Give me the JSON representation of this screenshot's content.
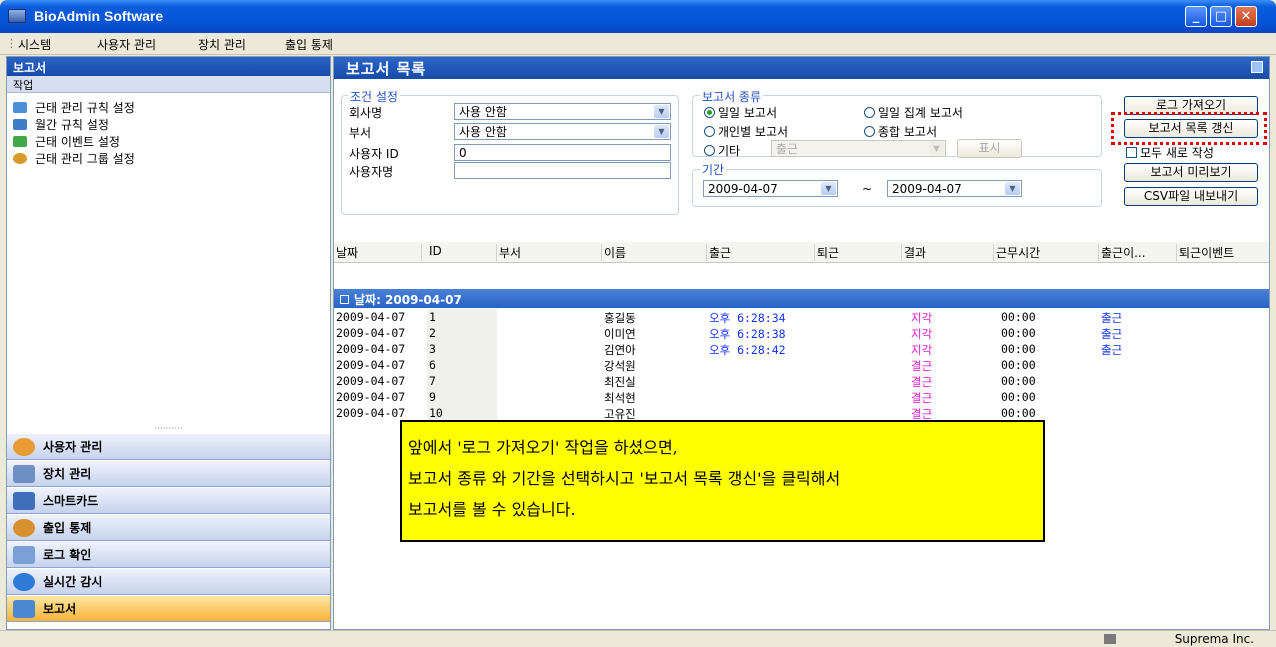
{
  "window": {
    "title": "BioAdmin Software"
  },
  "menu": [
    "시스템",
    "사용자 관리",
    "장치 관리",
    "출입 통제"
  ],
  "sidebar": {
    "header": "보고서",
    "subheader": "작업",
    "tasks": [
      "근태 관리 규칙 설정",
      "월간 규칙 설정",
      "근태 이벤트 설정",
      "근태 관리 그룹 설정"
    ],
    "nav": [
      "사용자 관리",
      "장치 관리",
      "스마트카드",
      "출입 통제",
      "로그 확인",
      "실시간 감시",
      "보고서"
    ]
  },
  "main": {
    "title": "보고서 목록",
    "conditions": {
      "legend": "조건 설정",
      "company_label": "회사명",
      "company_value": "사용 안함",
      "dept_label": "부서",
      "dept_value": "사용 안함",
      "userid_label": "사용자 ID",
      "userid_value": "0",
      "username_label": "사용자명",
      "username_value": ""
    },
    "report_type": {
      "legend": "보고서 종류",
      "options": [
        "일일 보고서",
        "일일 집계 보고서",
        "개인별 보고서",
        "종합 보고서",
        "기타"
      ],
      "selected": "일일 보고서",
      "other_combo": "출근",
      "show_button": "표시"
    },
    "period": {
      "legend": "기간",
      "from": "2009-04-07",
      "to": "2009-04-07",
      "sep": "~"
    },
    "buttons": {
      "fetch_log": "로그 가져오기",
      "refresh": "보고서 목록 갱신",
      "rewrite": "모두 새로 작성",
      "preview": "보고서 미리보기",
      "export_csv": "CSV파일 내보내기"
    },
    "grid": {
      "columns": [
        "날짜",
        "ID",
        "부서",
        "이름",
        "출근",
        "퇴근",
        "결과",
        "근무시간",
        "출근이...",
        "퇴근이벤트"
      ],
      "group_label": "날짜: 2009-04-07",
      "rows": [
        {
          "date": "2009-04-07",
          "id": "1",
          "dept": "",
          "name": "홍길동",
          "in": "오후 6:28:34",
          "out": "",
          "result": "지각",
          "hours": "00:00",
          "in_event": "출근"
        },
        {
          "date": "2009-04-07",
          "id": "2",
          "dept": "",
          "name": "이미연",
          "in": "오후 6:28:38",
          "out": "",
          "result": "지각",
          "hours": "00:00",
          "in_event": "출근"
        },
        {
          "date": "2009-04-07",
          "id": "3",
          "dept": "",
          "name": "김연아",
          "in": "오후 6:28:42",
          "out": "",
          "result": "지각",
          "hours": "00:00",
          "in_event": "출근"
        },
        {
          "date": "2009-04-07",
          "id": "6",
          "dept": "",
          "name": "강석원",
          "in": "",
          "out": "",
          "result": "결근",
          "hours": "00:00",
          "in_event": ""
        },
        {
          "date": "2009-04-07",
          "id": "7",
          "dept": "",
          "name": "최진실",
          "in": "",
          "out": "",
          "result": "결근",
          "hours": "00:00",
          "in_event": ""
        },
        {
          "date": "2009-04-07",
          "id": "9",
          "dept": "",
          "name": "최석현",
          "in": "",
          "out": "",
          "result": "결근",
          "hours": "00:00",
          "in_event": ""
        },
        {
          "date": "2009-04-07",
          "id": "10",
          "dept": "",
          "name": "고유진",
          "in": "",
          "out": "",
          "result": "결근",
          "hours": "00:00",
          "in_event": ""
        }
      ]
    }
  },
  "note": {
    "line1": "앞에서 '로그 가져오기' 작업을 하셨으면,",
    "line2": "보고서 종류 와 기간을 선택하시고 '보고서 목록 갱신'을 클릭해서",
    "line3": "보고서를 볼 수 있습니다."
  },
  "status": {
    "company": "Suprema Inc."
  },
  "colors": {
    "title_blue": "#0553d6",
    "late": "#e021d6",
    "time": "#1432ff",
    "note_bg": "#ffff00",
    "highlight": "#e00000"
  }
}
